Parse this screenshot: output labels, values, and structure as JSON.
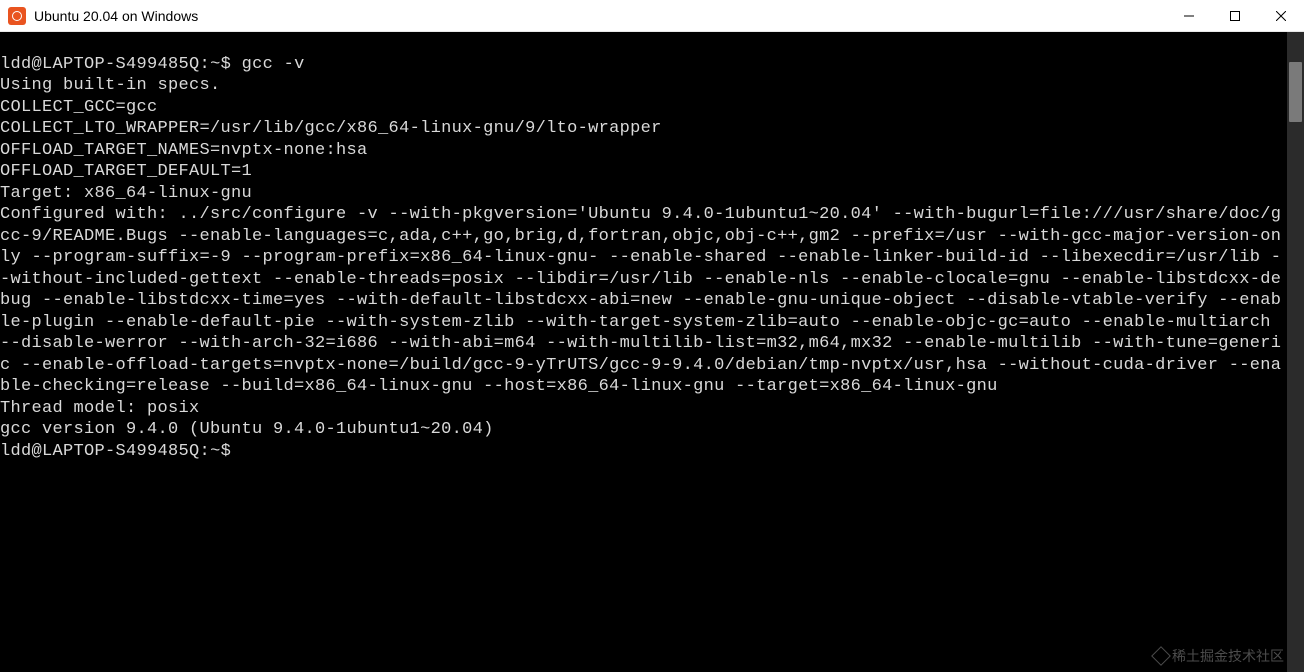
{
  "titlebar": {
    "title": "Ubuntu 20.04 on Windows"
  },
  "terminal": {
    "prompt_user_host": "ldd@LAPTOP-S499485Q",
    "prompt_sep": ":",
    "prompt_path": "~",
    "prompt_dollar": "$ ",
    "command": "gcc -v",
    "lines": [
      "Using built-in specs.",
      "COLLECT_GCC=gcc",
      "COLLECT_LTO_WRAPPER=/usr/lib/gcc/x86_64-linux-gnu/9/lto-wrapper",
      "OFFLOAD_TARGET_NAMES=nvptx-none:hsa",
      "OFFLOAD_TARGET_DEFAULT=1",
      "Target: x86_64-linux-gnu",
      "Configured with: ../src/configure -v --with-pkgversion='Ubuntu 9.4.0-1ubuntu1~20.04' --with-bugurl=file:///usr/share/doc/gcc-9/README.Bugs --enable-languages=c,ada,c++,go,brig,d,fortran,objc,obj-c++,gm2 --prefix=/usr --with-gcc-major-version-only --program-suffix=-9 --program-prefix=x86_64-linux-gnu- --enable-shared --enable-linker-build-id --libexecdir=/usr/lib --without-included-gettext --enable-threads=posix --libdir=/usr/lib --enable-nls --enable-clocale=gnu --enable-libstdcxx-debug --enable-libstdcxx-time=yes --with-default-libstdcxx-abi=new --enable-gnu-unique-object --disable-vtable-verify --enable-plugin --enable-default-pie --with-system-zlib --with-target-system-zlib=auto --enable-objc-gc=auto --enable-multiarch --disable-werror --with-arch-32=i686 --with-abi=m64 --with-multilib-list=m32,m64,mx32 --enable-multilib --with-tune=generic --enable-offload-targets=nvptx-none=/build/gcc-9-yTrUTS/gcc-9-9.4.0/debian/tmp-nvptx/usr,hsa --without-cuda-driver --enable-checking=release --build=x86_64-linux-gnu --host=x86_64-linux-gnu --target=x86_64-linux-gnu",
      "Thread model: posix",
      "gcc version 9.4.0 (Ubuntu 9.4.0-1ubuntu1~20.04)"
    ],
    "prompt2_user_host": "ldd@LAPTOP-S499485Q",
    "prompt2_path": "~",
    "prompt2_dollar": "$ "
  },
  "watermark": {
    "text": "稀土掘金技术社区"
  }
}
